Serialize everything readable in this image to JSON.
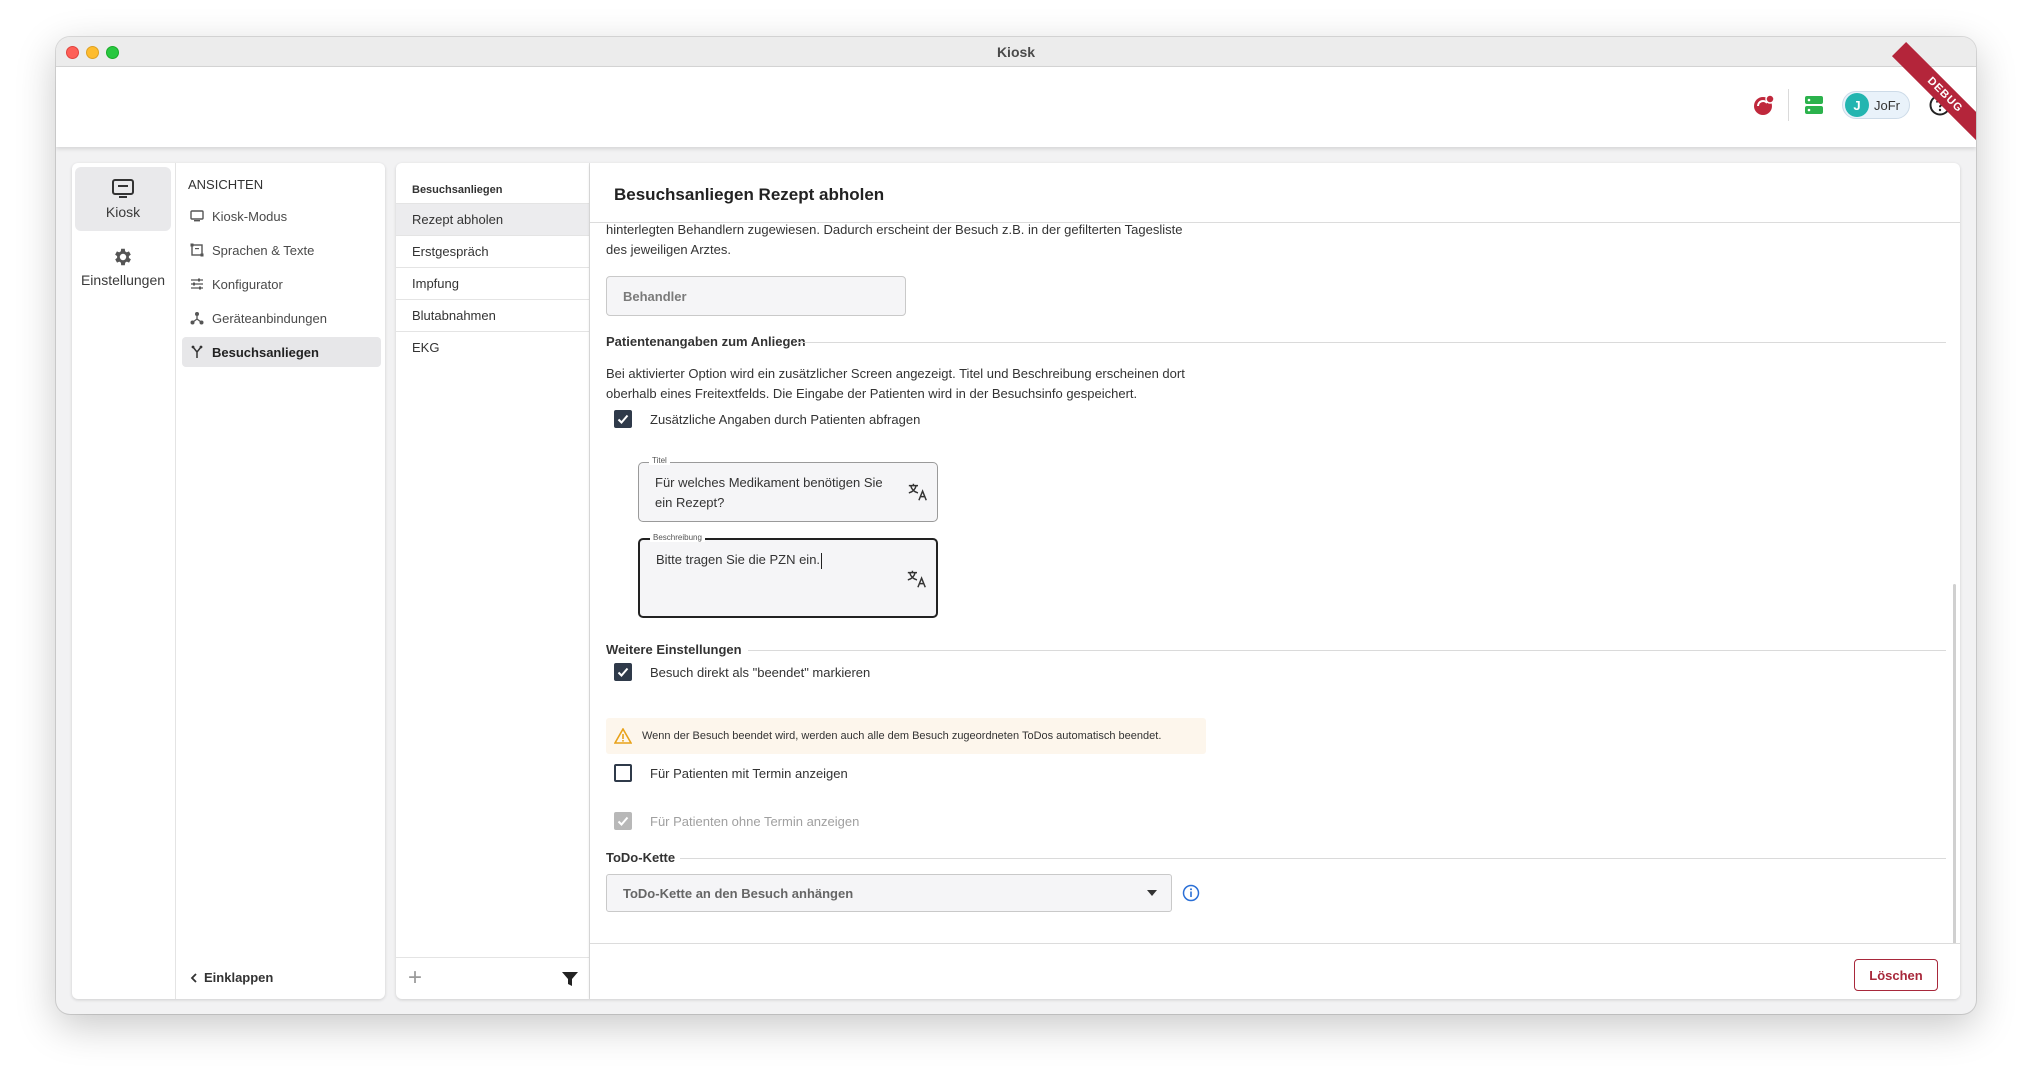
{
  "window": {
    "title": "Kiosk"
  },
  "header": {
    "user_initial": "J",
    "user_name": "JoFr",
    "debug_label": "DEBUG"
  },
  "rail": {
    "items": [
      {
        "label": "Kiosk",
        "icon": "monitor-icon",
        "active": true
      },
      {
        "label": "Einstellungen",
        "icon": "gear-icon",
        "active": false
      }
    ]
  },
  "views": {
    "title": "ANSICHTEN",
    "items": [
      {
        "label": "Kiosk-Modus",
        "icon": "monitor-icon"
      },
      {
        "label": "Sprachen & Texte",
        "icon": "text-frame-icon"
      },
      {
        "label": "Konfigurator",
        "icon": "sliders-icon"
      },
      {
        "label": "Geräteanbindungen",
        "icon": "network-icon"
      },
      {
        "label": "Besuchsanliegen",
        "icon": "fork-icon",
        "active": true
      }
    ],
    "collapse_label": "Einklappen"
  },
  "list": {
    "title": "Besuchsanliegen",
    "items": [
      "Rezept abholen",
      "Erstgespräch",
      "Impfung",
      "Blutabnahmen",
      "EKG"
    ],
    "selected": "Rezept abholen"
  },
  "main": {
    "title": "Besuchsanliegen Rezept abholen",
    "intro_line1": "hinterlegten Behandlern zugewiesen. Dadurch erscheint der Besuch z.B. in der gefilterten Tagesliste",
    "intro_line2": "des jeweiligen Arztes.",
    "behandler_placeholder": "Behandler",
    "patient_section": {
      "title": "Patientenangaben zum Anliegen",
      "desc_line1": "Bei aktivierter Option wird ein zusätzlicher Screen angezeigt. Titel und Beschreibung erscheinen dort",
      "desc_line2": "oberhalb eines Freitextfelds. Die Eingabe der Patienten wird in der Besuchsinfo gespeichert.",
      "ask_checkbox": {
        "label": "Zusätzliche Angaben durch Patienten abfragen",
        "checked": true
      },
      "title_field": {
        "label": "Titel",
        "value": "Für welches Medikament benötigen Sie ein Rezept?"
      },
      "desc_field": {
        "label": "Beschreibung",
        "value": "Bitte tragen Sie die PZN ein."
      }
    },
    "further_section": {
      "title": "Weitere Einstellungen",
      "finish_checkbox": {
        "label": "Besuch direkt als \"beendet\" markieren",
        "checked": true
      },
      "warning": "Wenn der Besuch beendet wird, werden auch alle dem Besuch zugeordneten ToDos automatisch beendet.",
      "with_appointment": {
        "label": "Für Patienten mit Termin anzeigen",
        "checked": false
      },
      "without_appointment": {
        "label": "Für Patienten ohne Termin anzeigen",
        "checked": true,
        "disabled": true
      }
    },
    "todo_section": {
      "title": "ToDo-Kette",
      "select_value": "ToDo-Kette an den Besuch anhängen"
    },
    "delete_label": "Löschen"
  },
  "colors": {
    "accent_dark": "#2f3a4a",
    "danger": "#a8283b",
    "warning_bg": "#fdf6ec",
    "warning_icon": "#e8a21a",
    "info_blue": "#2a6fd6",
    "status_green": "#2bb24c",
    "avatar_teal": "#23b5b0"
  }
}
